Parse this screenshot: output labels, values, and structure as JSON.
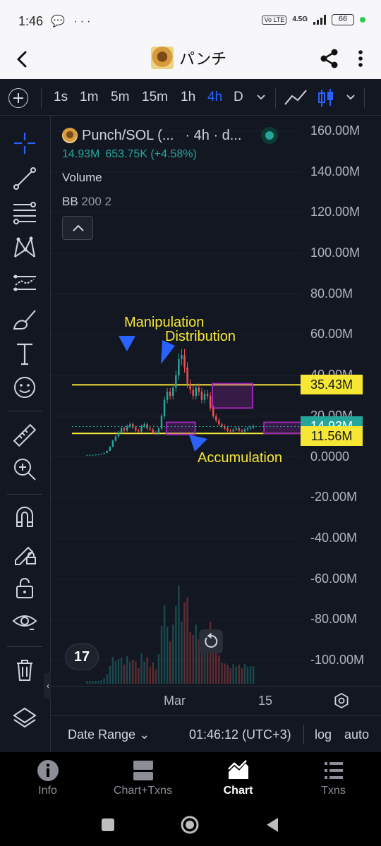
{
  "status_bar": {
    "time": "1:46",
    "left_icons": "💬 ···",
    "volte": "Vo LTE",
    "network": "4.5G",
    "battery": "66"
  },
  "app_bar": {
    "title": "パンチ"
  },
  "toolbar": {
    "intervals": [
      "1s",
      "1m",
      "5m",
      "15m",
      "1h",
      "4h",
      "D"
    ],
    "active_interval": "4h"
  },
  "left_tools": [
    "crosshair-icon",
    "trendline-icon",
    "fib-retracement-icon",
    "pattern-icon",
    "prediction-icon",
    "brush-icon",
    "text-icon",
    "emoji-icon",
    "ruler-icon",
    "zoom-icon",
    "magnet-icon",
    "lock-drawings-icon",
    "unlock-icon",
    "eye-icon",
    "trash-icon",
    "layers-icon"
  ],
  "legend": {
    "symbol": "Punch/SOL (...",
    "interval_source": "· 4h · d...",
    "last_price": "14.93M",
    "change": "653.75K (+4.58%)",
    "volume_label": "Volume",
    "indicator_name": "BB",
    "indicator_params": "200 2"
  },
  "price_axis": {
    "labels": [
      "160.00M",
      "140.00M",
      "120.00M",
      "100.00M",
      "80.00M",
      "60.00M",
      "40.00M",
      "20.00M",
      "0.0000",
      "-20.00M",
      "-40.00M",
      "-60.00M",
      "-80.00M",
      "-100.00M"
    ],
    "values": [
      160,
      140,
      120,
      100,
      80,
      60,
      40,
      20,
      0,
      -20,
      -40,
      -60,
      -80,
      -100
    ],
    "tags": [
      {
        "label": "35.43M",
        "value": 35.43,
        "bg": "#f5e733",
        "fg": "#131722"
      },
      {
        "label": "14.93M",
        "value": 14.93,
        "bg": "#26a69a",
        "fg": "#ffffff"
      },
      {
        "label": "11.56M",
        "value": 11.56,
        "bg": "#f5e733",
        "fg": "#131722"
      }
    ]
  },
  "annotations": {
    "manipulation": "Manipulation",
    "distribution": "Distribution",
    "accumulation": "Accumulation"
  },
  "horizontal_lines": [
    {
      "value": 35.43,
      "color": "#f5e733"
    },
    {
      "value": 11.56,
      "color": "#f5e733"
    }
  ],
  "zones": [
    {
      "name": "zone-1",
      "from": 28,
      "to": 38,
      "low": 11,
      "high": 17,
      "color": "#9c27b0"
    },
    {
      "name": "manipulation-zone",
      "from": 44,
      "to": 58,
      "low": 24,
      "high": 36,
      "color": "#9c27b0"
    },
    {
      "name": "accumulation-zone",
      "from": 62,
      "to": 78,
      "low": 11.5,
      "high": 17,
      "color": "#9c27b0"
    }
  ],
  "chart_data": {
    "type": "candlestick",
    "ylim": [
      -100,
      160
    ],
    "price_series": [
      1.0,
      1.0,
      1.0,
      1.1,
      1.2,
      1.5,
      2.0,
      3.0,
      5.0,
      8.0,
      10.0,
      12.0,
      14.0,
      13.0,
      15.0,
      16.0,
      14.5,
      13.0,
      12.5,
      15.0,
      16.0,
      14.0,
      13.5,
      12.0,
      11.5,
      14.0,
      20.0,
      28.0,
      32.0,
      30.0,
      34.0,
      40.0,
      48.0,
      50.0,
      44.0,
      36.0,
      33.0,
      30.0,
      34.0,
      32.0,
      28.0,
      31.0,
      30.0,
      24.0,
      20.0,
      18.0,
      16.0,
      15.0,
      14.0,
      13.0,
      12.5,
      13.5,
      14.0,
      13.0,
      12.5,
      13.5,
      14.0,
      14.5,
      14.93
    ],
    "volume_note": "volume histogram shown at bottom of chart",
    "x_tick_labels": [
      "Mar",
      "15"
    ],
    "colors": {
      "up": "#26a69a",
      "down": "#ef5350"
    }
  },
  "x_axis": {
    "labels": [
      "Mar",
      "15"
    ]
  },
  "bottom_bar": {
    "date_range": "Date Range",
    "time": "01:46:12 (UTC+3)",
    "log": "log",
    "auto": "auto"
  },
  "bottom_nav": [
    {
      "label": "Info",
      "icon": "info-icon",
      "active": false
    },
    {
      "label": "Chart+Txns",
      "icon": "chart-txns-icon",
      "active": false
    },
    {
      "label": "Chart",
      "icon": "chart-icon",
      "active": true
    },
    {
      "label": "Txns",
      "icon": "list-icon",
      "active": false
    }
  ]
}
